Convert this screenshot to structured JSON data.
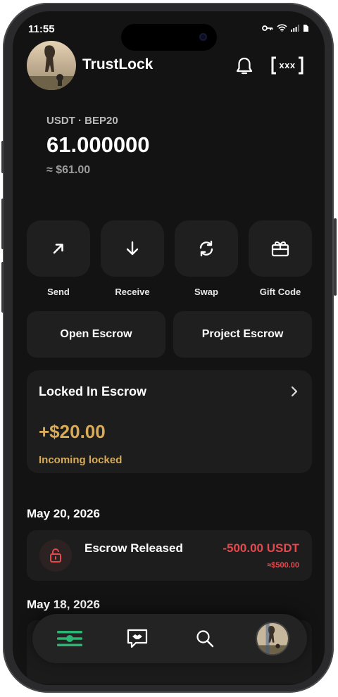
{
  "status_bar": {
    "time": "11:55"
  },
  "header": {
    "app_name": "TrustLock",
    "qr_text": "xxx"
  },
  "wallet": {
    "asset": "USDT · BEP20",
    "balance": "61.000000",
    "fiat": "≈ $61.00"
  },
  "actions": [
    {
      "label": "Send",
      "icon": "arrow-up-right-icon"
    },
    {
      "label": "Receive",
      "icon": "arrow-down-icon"
    },
    {
      "label": "Swap",
      "icon": "swap-icon"
    },
    {
      "label": "Gift Code",
      "icon": "gift-icon"
    }
  ],
  "escrow_buttons": {
    "open": "Open Escrow",
    "project": "Project Escrow"
  },
  "locked": {
    "title": "Locked In Escrow",
    "amount": "+$20.00",
    "subtitle": "Incoming locked"
  },
  "transactions": [
    {
      "date": "May 20, 2026",
      "name": "Escrow Released",
      "value": "-500.00 USDT",
      "fiat": "≈$500.00"
    }
  ],
  "next_date": "May 18, 2026",
  "colors": {
    "background": "#131313",
    "card": "#1f1f1f",
    "gold": "#d9ab57",
    "negative": "#e5484d",
    "accent_green": "#2bb673"
  },
  "nav": [
    "menu-icon",
    "handshake-chat-icon",
    "search-icon",
    "profile-avatar"
  ]
}
